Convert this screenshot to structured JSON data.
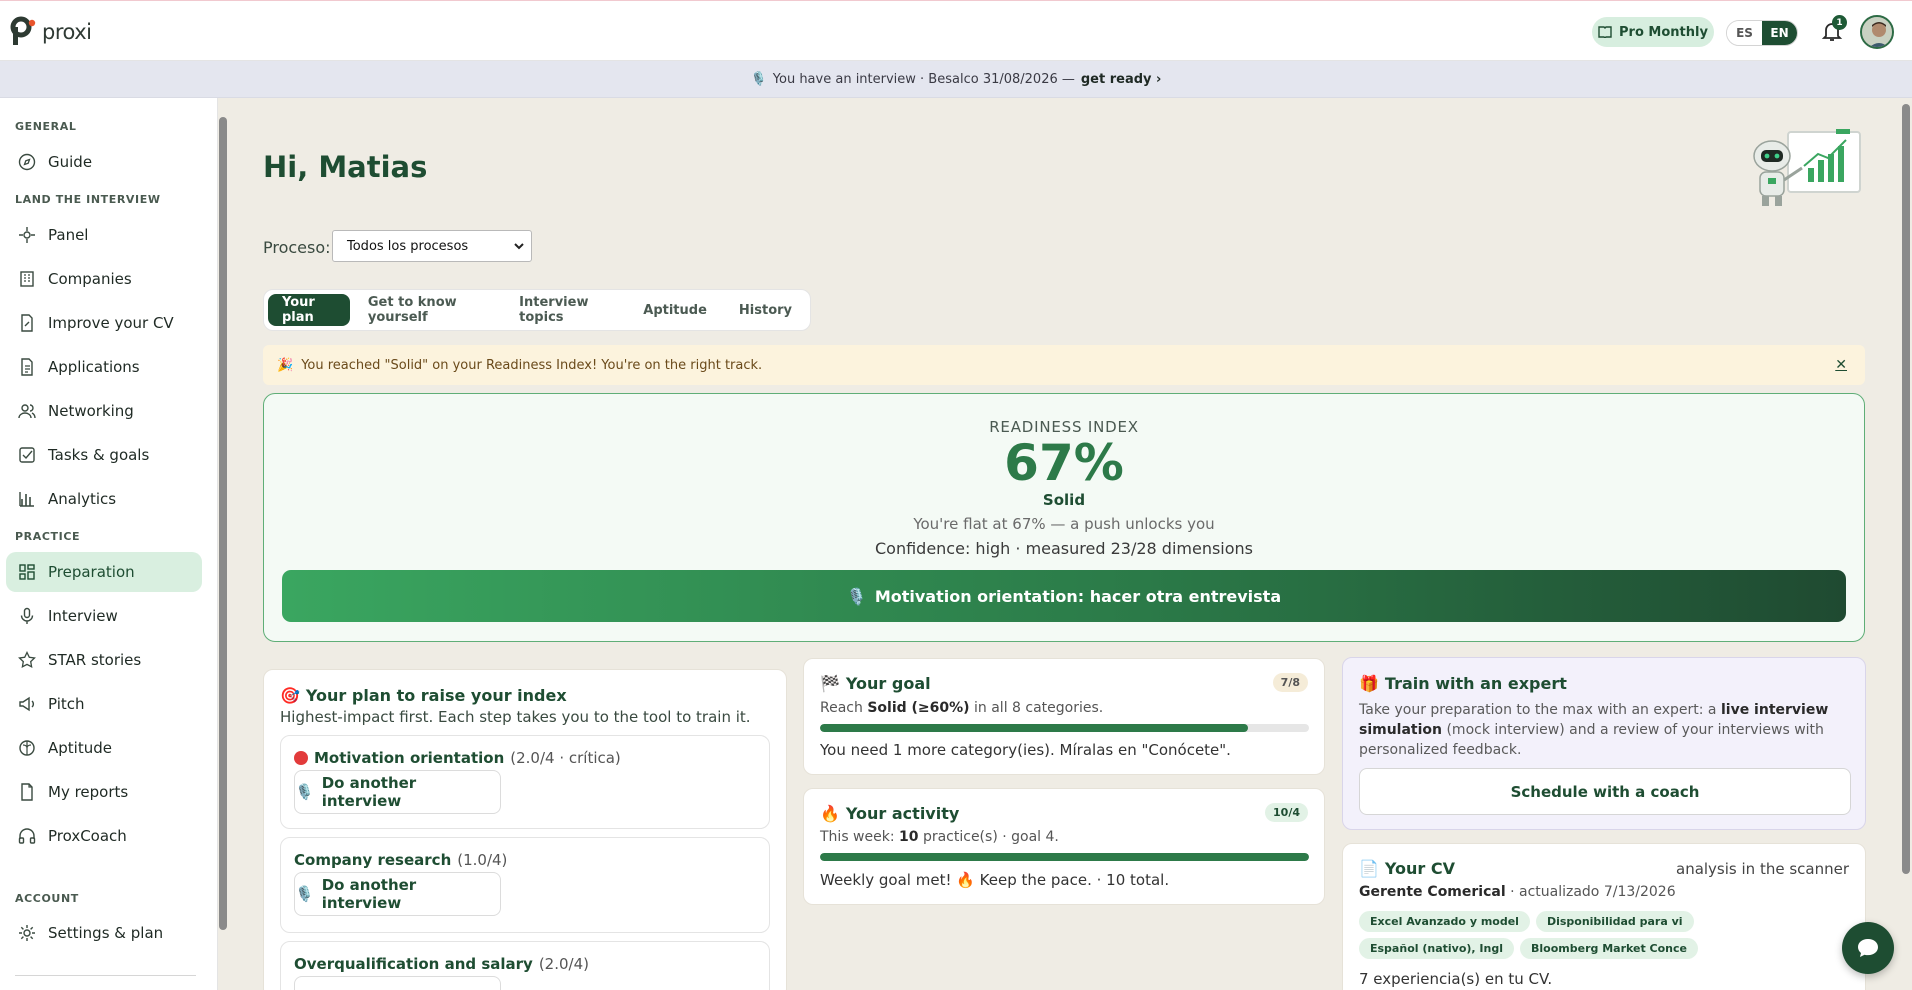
{
  "app": {
    "name": "proxi"
  },
  "header": {
    "plan_label": "Pro Monthly",
    "lang_es": "ES",
    "lang_en": "EN",
    "notification_count": "1"
  },
  "banner": {
    "icon": "microphone-icon",
    "text": "You have an interview · Besalco 31/08/2026 —",
    "cta": "get ready ›"
  },
  "sidebar": {
    "sections": {
      "general": "GENERAL",
      "land": "LAND THE INTERVIEW",
      "practice": "PRACTICE",
      "account": "ACCOUNT"
    },
    "items": [
      {
        "label": "Guide",
        "icon": "compass-icon"
      },
      {
        "label": "Panel",
        "icon": "target-icon"
      },
      {
        "label": "Companies",
        "icon": "building-icon"
      },
      {
        "label": "Improve your CV",
        "icon": "document-edit-icon"
      },
      {
        "label": "Applications",
        "icon": "file-text-icon"
      },
      {
        "label": "Networking",
        "icon": "users-icon"
      },
      {
        "label": "Tasks & goals",
        "icon": "check-square-icon"
      },
      {
        "label": "Analytics",
        "icon": "bar-chart-icon"
      },
      {
        "label": "Preparation",
        "icon": "grid-icon",
        "active": true
      },
      {
        "label": "Interview",
        "icon": "microphone-icon"
      },
      {
        "label": "STAR stories",
        "icon": "star-icon"
      },
      {
        "label": "Pitch",
        "icon": "megaphone-icon"
      },
      {
        "label": "Aptitude",
        "icon": "brain-icon"
      },
      {
        "label": "My reports",
        "icon": "file-icon"
      },
      {
        "label": "ProxCoach",
        "icon": "headphones-icon"
      },
      {
        "label": "Settings & plan",
        "icon": "gear-icon"
      }
    ]
  },
  "main": {
    "greeting": "Hi, Matias",
    "process_label": "Proceso:",
    "process_selected": "Todos los procesos",
    "tabs": [
      {
        "label": "Your plan",
        "active": true
      },
      {
        "label": "Get to know yourself"
      },
      {
        "label": "Interview topics"
      },
      {
        "label": "Aptitude"
      },
      {
        "label": "History"
      }
    ],
    "toast": {
      "icon": "party-icon",
      "text": "You reached \"Solid\" on your Readiness Index! You're on the right track.",
      "close": "✕"
    },
    "readiness": {
      "label": "READINESS INDEX",
      "percent": "67%",
      "percent_value": 67,
      "level": "Solid",
      "subtitle": "You're flat at 67% — a push unlocks you",
      "confidence": "Confidence: high · measured 23/28 dimensions",
      "cta": "Motivation orientation: hacer otra entrevista"
    },
    "plan": {
      "title": "Your plan to raise your index",
      "subtitle": "Highest-impact first. Each step takes you to the tool to train it.",
      "items": [
        {
          "name": "Motivation orientation",
          "meta": "(2.0/4 · crítica)",
          "action": "Do another interview",
          "critical": true
        },
        {
          "name": "Company research",
          "meta": "(1.0/4)",
          "action": "Do another interview"
        },
        {
          "name": "Overqualification and salary",
          "meta": "(2.0/4)",
          "action": ""
        }
      ]
    },
    "goal": {
      "title": "Your goal",
      "badge": "7/8",
      "text_pre": "Reach",
      "text_bold": "Solid (≥60%)",
      "text_post": "in all 8 categories.",
      "progress": 0.875,
      "note": "You need 1 more category(ies). Míralas en \"Conócete\"."
    },
    "activity": {
      "title": "Your activity",
      "badge": "10/4",
      "text_pre": "This week:",
      "text_bold": "10",
      "text_post": "practice(s) · goal 4.",
      "progress": 1.0,
      "note": "Weekly goal met! 🔥 Keep the pace. · 10 total."
    },
    "expert": {
      "title": "Train with an expert",
      "text_1": "Take your preparation to the max with an expert: a",
      "text_bold": "live interview simulation",
      "text_2": "(mock interview) and a review of your interviews with personalized feedback.",
      "cta": "Schedule with a coach"
    },
    "cv": {
      "title": "Your CV",
      "link": "analysis in the scanner",
      "role": "Gerente Comerical",
      "updated": "· actualizado 7/13/2026",
      "chips": [
        "Excel Avanzado y model",
        "Disponibilidad para vi",
        "Español (nativo), Ingl",
        "Bloomberg Market Conce"
      ],
      "experience": "7 experiencia(s) en tu CV."
    }
  }
}
